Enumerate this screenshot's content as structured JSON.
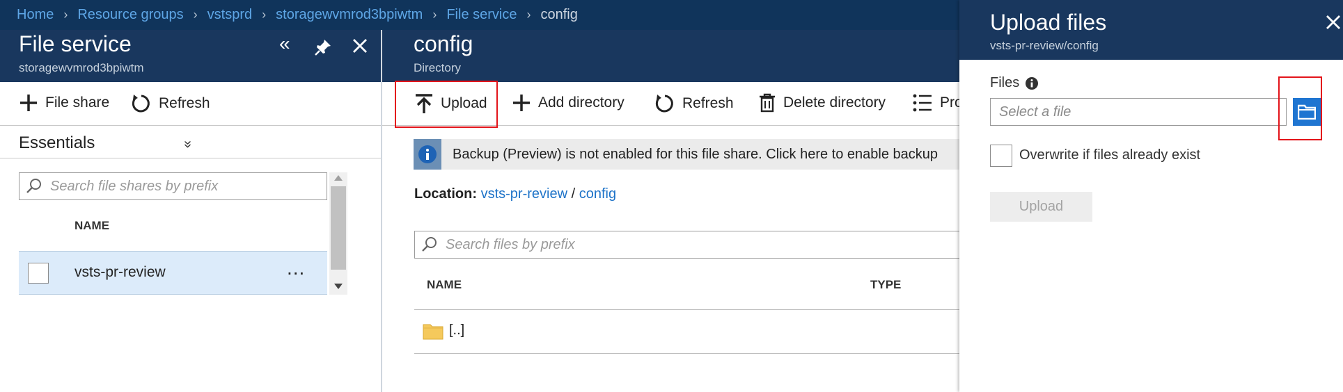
{
  "breadcrumb": {
    "items": [
      "Home",
      "Resource groups",
      "vstsprd",
      "storagewvmrod3bpiwtm",
      "File service"
    ],
    "current": "config"
  },
  "left_blade": {
    "title": "File service",
    "subtitle": "storagewvmrod3bpiwtm",
    "commands": {
      "file_share": "File share",
      "refresh": "Refresh"
    },
    "essentials_label": "Essentials",
    "search_placeholder": "Search file shares by prefix",
    "column_name": "NAME",
    "shares": [
      {
        "name": "vsts-pr-review",
        "more": "..."
      }
    ]
  },
  "center_blade": {
    "title": "config",
    "subtitle": "Directory",
    "commands": {
      "upload": "Upload",
      "add_directory": "Add directory",
      "refresh": "Refresh",
      "delete_directory": "Delete directory",
      "properties_partial": "Pro"
    },
    "banner_text": "Backup (Preview) is not enabled for this file share. Click here to enable backup",
    "location": {
      "label": "Location:",
      "share": "vsts-pr-review",
      "separator": "/",
      "folder": "config"
    },
    "search_placeholder": "Search files by prefix",
    "columns": {
      "name": "NAME",
      "type": "TYPE"
    },
    "rows": [
      {
        "name": "[..]",
        "type": ""
      }
    ]
  },
  "upload_panel": {
    "title": "Upload files",
    "subtitle": "vsts-pr-review/config",
    "files_label": "Files",
    "file_placeholder": "Select a file",
    "overwrite_label": "Overwrite if files already exist",
    "upload_button": "Upload"
  },
  "colors": {
    "header_bg": "#19375e",
    "breadcrumb_bg": "#10345b",
    "link": "#1e73c8",
    "accent_button": "#1f75d1",
    "highlight_red": "#e3141a",
    "selected_row": "#dcebfa"
  }
}
